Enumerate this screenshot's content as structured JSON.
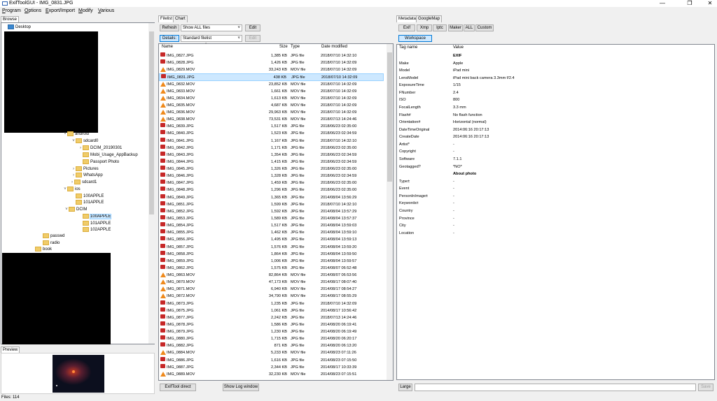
{
  "window": {
    "title": "ExifToolGUI - IMG_0831.JPG",
    "min": "—",
    "max": "❐",
    "close": "✕"
  },
  "menu": [
    {
      "label": "Program",
      "u": "P",
      "rest": "rogram"
    },
    {
      "label": "Options",
      "u": "O",
      "rest": "ptions"
    },
    {
      "label": "Export/Import",
      "u": "E",
      "rest": "xport/Import"
    },
    {
      "label": "Modify",
      "u": "M",
      "rest": "odify"
    },
    {
      "label": "Various",
      "u": "V",
      "rest": "arious"
    }
  ],
  "left": {
    "tab": "Browse",
    "tree": [
      {
        "label": "Desktop",
        "exp": "",
        "blue": true
      },
      {
        "label": "android",
        "exp": "˅"
      },
      {
        "label": "sdcard0",
        "exp": "˅"
      },
      {
        "label": "DCIM_20190301",
        "exp": "›"
      },
      {
        "label": "Mobi_Usage_AppBackup",
        "exp": ""
      },
      {
        "label": "Passport Photo",
        "exp": ""
      },
      {
        "label": "Pictures",
        "exp": "›"
      },
      {
        "label": "WhatsApp",
        "exp": "›"
      },
      {
        "label": "sdcard1",
        "exp": "›"
      },
      {
        "label": "ios",
        "exp": "˅"
      },
      {
        "label": "100APPLE",
        "exp": ""
      },
      {
        "label": "101APPLE",
        "exp": ""
      },
      {
        "label": "DCIM",
        "exp": "˅"
      },
      {
        "label": "100APPLE",
        "exp": "",
        "selected": true
      },
      {
        "label": "101APPLE",
        "exp": ""
      },
      {
        "label": "102APPLE",
        "exp": ""
      },
      {
        "label": "passwd",
        "exp": ""
      },
      {
        "label": "radio",
        "exp": ""
      },
      {
        "label": "book",
        "exp": ""
      }
    ],
    "preview_tab": "Preview",
    "status": "Files: 114"
  },
  "middle": {
    "tabs": [
      "Filelist",
      "Chart"
    ],
    "refresh": "Refresh",
    "filter": "Show ALL files",
    "edit": "Edit",
    "details": "Details:",
    "fileview": "Standard filelist",
    "edit2": "Edit",
    "columns": {
      "name": "Name",
      "size": "Size",
      "type": "Type",
      "date": "Date modified"
    },
    "files": [
      {
        "name": "IMG_0827.JPG",
        "size": "1,385 KB",
        "type": "JPG file",
        "date": "2018/07/10 14:32:10"
      },
      {
        "name": "IMG_0828.JPG",
        "size": "1,426 KB",
        "type": "JPG file",
        "date": "2018/07/10 14:32:09"
      },
      {
        "name": "IMG_0829.MOV",
        "size": "33,243 KB",
        "type": "MOV file",
        "date": "2018/07/10 14:32:09"
      },
      {
        "name": "IMG_0831.JPG",
        "size": "438 KB",
        "type": "JPG file",
        "date": "2018/07/10 14:32:09",
        "selected": true
      },
      {
        "name": "IMG_0832.MOV",
        "size": "23,852 KB",
        "type": "MOV file",
        "date": "2018/07/10 14:32:09"
      },
      {
        "name": "IMG_0833.MOV",
        "size": "1,661 KB",
        "type": "MOV file",
        "date": "2018/07/10 14:32:09"
      },
      {
        "name": "IMG_0834.MOV",
        "size": "1,613 KB",
        "type": "MOV file",
        "date": "2018/07/10 14:32:09"
      },
      {
        "name": "IMG_0835.MOV",
        "size": "4,687 KB",
        "type": "MOV file",
        "date": "2018/07/10 14:32:09"
      },
      {
        "name": "IMG_0836.MOV",
        "size": "29,963 KB",
        "type": "MOV file",
        "date": "2018/07/10 14:32:09"
      },
      {
        "name": "IMG_0838.MOV",
        "size": "73,531 KB",
        "type": "MOV file",
        "date": "2018/07/13 14:24:46"
      },
      {
        "name": "IMG_0839.JPG",
        "size": "1,517 KB",
        "type": "JPG file",
        "date": "2018/06/23 02:35:00"
      },
      {
        "name": "IMG_0840.JPG",
        "size": "1,523 KB",
        "type": "JPG file",
        "date": "2018/06/23 02:34:59"
      },
      {
        "name": "IMG_0841.JPG",
        "size": "1,167 KB",
        "type": "JPG file",
        "date": "2018/07/10 14:32:10"
      },
      {
        "name": "IMG_0842.JPG",
        "size": "1,171 KB",
        "type": "JPG file",
        "date": "2018/06/23 02:35:00"
      },
      {
        "name": "IMG_0843.JPG",
        "size": "1,354 KB",
        "type": "JPG file",
        "date": "2018/06/23 02:34:59"
      },
      {
        "name": "IMG_0844.JPG",
        "size": "1,415 KB",
        "type": "JPG file",
        "date": "2018/06/23 02:34:59"
      },
      {
        "name": "IMG_0845.JPG",
        "size": "1,326 KB",
        "type": "JPG file",
        "date": "2018/06/23 02:35:00"
      },
      {
        "name": "IMG_0846.JPG",
        "size": "1,328 KB",
        "type": "JPG file",
        "date": "2018/06/23 02:34:59"
      },
      {
        "name": "IMG_0847.JPG",
        "size": "1,459 KB",
        "type": "JPG file",
        "date": "2018/06/23 02:35:00"
      },
      {
        "name": "IMG_0848.JPG",
        "size": "1,296 KB",
        "type": "JPG file",
        "date": "2018/06/23 02:35:00"
      },
      {
        "name": "IMG_0849.JPG",
        "size": "1,365 KB",
        "type": "JPG file",
        "date": "2014/08/04 13:56:29"
      },
      {
        "name": "IMG_0851.JPG",
        "size": "1,599 KB",
        "type": "JPG file",
        "date": "2018/07/10 14:32:10"
      },
      {
        "name": "IMG_0852.JPG",
        "size": "1,592 KB",
        "type": "JPG file",
        "date": "2014/08/04 13:57:29"
      },
      {
        "name": "IMG_0853.JPG",
        "size": "1,589 KB",
        "type": "JPG file",
        "date": "2014/08/04 13:57:37"
      },
      {
        "name": "IMG_0854.JPG",
        "size": "1,517 KB",
        "type": "JPG file",
        "date": "2014/08/04 13:59:03"
      },
      {
        "name": "IMG_0855.JPG",
        "size": "1,462 KB",
        "type": "JPG file",
        "date": "2014/08/04 13:59:10"
      },
      {
        "name": "IMG_0856.JPG",
        "size": "1,495 KB",
        "type": "JPG file",
        "date": "2014/08/04 13:59:13"
      },
      {
        "name": "IMG_0857.JPG",
        "size": "1,576 KB",
        "type": "JPG file",
        "date": "2014/08/04 13:59:20"
      },
      {
        "name": "IMG_0858.JPG",
        "size": "1,864 KB",
        "type": "JPG file",
        "date": "2014/08/04 13:59:50"
      },
      {
        "name": "IMG_0859.JPG",
        "size": "1,006 KB",
        "type": "JPG file",
        "date": "2014/08/04 13:59:57"
      },
      {
        "name": "IMG_0862.JPG",
        "size": "1,575 KB",
        "type": "JPG file",
        "date": "2014/08/07 06:52:48"
      },
      {
        "name": "IMG_0863.MOV",
        "size": "82,864 KB",
        "type": "MOV file",
        "date": "2014/08/07 06:53:56"
      },
      {
        "name": "IMG_0870.MOV",
        "size": "47,173 KB",
        "type": "MOV file",
        "date": "2014/08/17 08:07:40"
      },
      {
        "name": "IMG_0871.MOV",
        "size": "6,940 KB",
        "type": "MOV file",
        "date": "2014/08/17 08:54:27"
      },
      {
        "name": "IMG_0872.MOV",
        "size": "34,790 KB",
        "type": "MOV file",
        "date": "2014/08/17 08:55:29"
      },
      {
        "name": "IMG_0873.JPG",
        "size": "1,235 KB",
        "type": "JPG file",
        "date": "2018/07/10 14:32:09"
      },
      {
        "name": "IMG_0875.JPG",
        "size": "1,061 KB",
        "type": "JPG file",
        "date": "2014/08/17 10:56:42"
      },
      {
        "name": "IMG_0877.JPG",
        "size": "2,242 KB",
        "type": "JPG file",
        "date": "2018/07/13 14:24:46"
      },
      {
        "name": "IMG_0878.JPG",
        "size": "1,586 KB",
        "type": "JPG file",
        "date": "2014/08/20 06:19:41"
      },
      {
        "name": "IMG_0879.JPG",
        "size": "1,230 KB",
        "type": "JPG file",
        "date": "2014/08/20 06:19:49"
      },
      {
        "name": "IMG_0880.JPG",
        "size": "1,715 KB",
        "type": "JPG file",
        "date": "2014/08/20 06:20:17"
      },
      {
        "name": "IMG_0882.JPG",
        "size": "871 KB",
        "type": "JPG file",
        "date": "2014/08/20 06:13:20"
      },
      {
        "name": "IMG_0884.MOV",
        "size": "5,233 KB",
        "type": "MOV file",
        "date": "2014/08/23 07:11:26"
      },
      {
        "name": "IMG_0886.JPG",
        "size": "1,616 KB",
        "type": "JPG file",
        "date": "2014/08/23 07:15:50"
      },
      {
        "name": "IMG_0887.JPG",
        "size": "2,344 KB",
        "type": "JPG file",
        "date": "2014/08/17 10:33:39"
      },
      {
        "name": "IMG_0889.MOV",
        "size": "32,230 KB",
        "type": "MOV file",
        "date": "2014/08/23 07:15:51"
      }
    ],
    "exiftool_direct": "ExifTool direct",
    "show_log": "Show Log window"
  },
  "right": {
    "tabs": [
      "Metadata",
      "GoogleMap"
    ],
    "buttons": [
      "Exif",
      "Xmp",
      "Iptc",
      "Maker",
      "ALL",
      "Custom"
    ],
    "workspace": "Workspace",
    "columns": {
      "tag": "Tag name",
      "value": "Value"
    },
    "rows": [
      {
        "tag": "",
        "value": "EXIF",
        "bold": true
      },
      {
        "tag": "Make",
        "value": "Apple"
      },
      {
        "tag": "Model",
        "value": "iPad mini"
      },
      {
        "tag": "LensModel",
        "value": "iPad mini back camera 3.3mm f/2.4"
      },
      {
        "tag": "ExposureTime",
        "value": "1/15"
      },
      {
        "tag": "FNumber",
        "value": "2.4"
      },
      {
        "tag": "ISO",
        "value": "800"
      },
      {
        "tag": "FocalLength",
        "value": "3.3 mm"
      },
      {
        "tag": "Flash#",
        "value": "No flash function"
      },
      {
        "tag": "Orientation#",
        "value": "Horizontal (normal)"
      },
      {
        "tag": "DateTimeOriginal",
        "value": "2014:06:16 20:17:13"
      },
      {
        "tag": "CreateDate",
        "value": "2014:06:16 20:17:13"
      },
      {
        "tag": "Artist*",
        "value": "-"
      },
      {
        "tag": "Copyright",
        "value": "-"
      },
      {
        "tag": "Software",
        "value": "7.1.1"
      },
      {
        "tag": "Geotagged?",
        "value": "*NO*"
      },
      {
        "tag": "",
        "value": "About photo",
        "bold": true
      },
      {
        "tag": "Type±",
        "value": "-"
      },
      {
        "tag": "Event",
        "value": "-"
      },
      {
        "tag": "PersonInImage±",
        "value": "-"
      },
      {
        "tag": "Keywords±",
        "value": "-"
      },
      {
        "tag": "Country",
        "value": "-"
      },
      {
        "tag": "Province",
        "value": "-"
      },
      {
        "tag": "City",
        "value": "-"
      },
      {
        "tag": "Location",
        "value": "-"
      }
    ],
    "large": "Large",
    "edit_value": "",
    "save": "Save"
  }
}
